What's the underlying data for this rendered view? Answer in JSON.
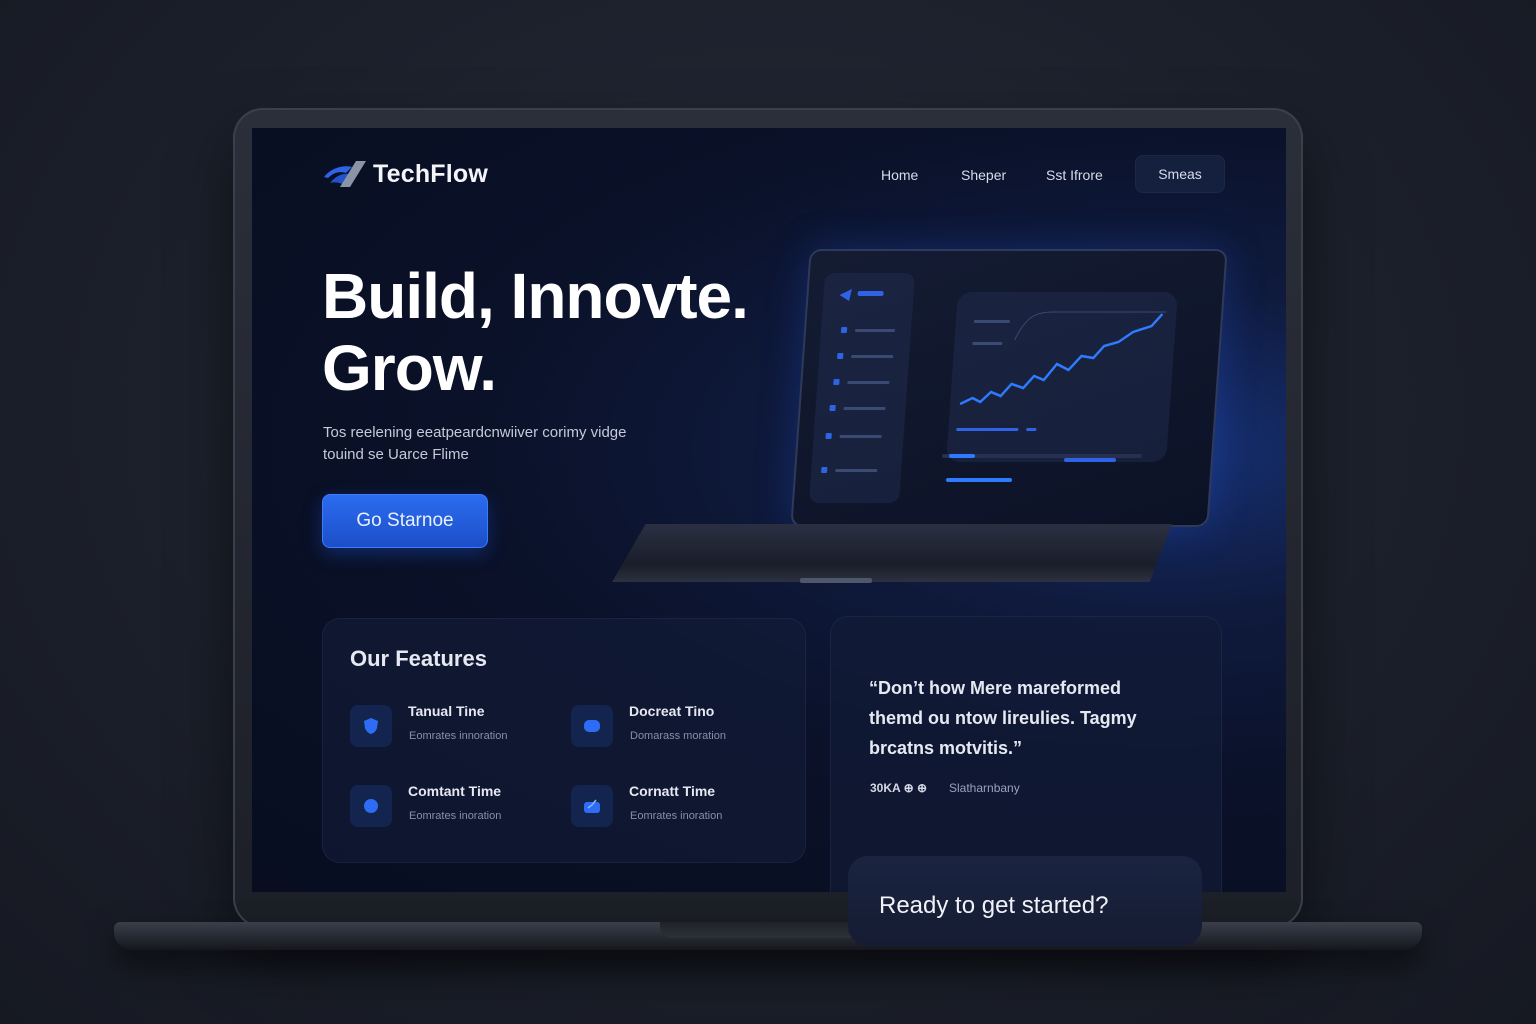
{
  "brand": {
    "name": "TechFlow"
  },
  "nav": {
    "links": [
      "Home",
      "Sheper",
      "Sst Ifrore"
    ],
    "button": "Smeas"
  },
  "hero": {
    "title_line1": "Build, Innovte.",
    "title_line2": "Grow.",
    "subtitle_line1": "Tos reelening eeatpeardcnwiiver corimy vidge",
    "subtitle_line2": "touind se Uarce Flime",
    "cta": "Go Starnoe"
  },
  "features": {
    "title": "Our Features",
    "items": [
      {
        "name": "Tanual Tine",
        "desc": "Eomrates innoration",
        "icon": "shield-icon"
      },
      {
        "name": "Docreat Tino",
        "desc": "Domarass moration",
        "icon": "cloud-icon"
      },
      {
        "name": "Comtant Time",
        "desc": "Eomrates inoration",
        "icon": "gear-icon"
      },
      {
        "name": "Cornatt Time",
        "desc": "Eomrates inoration",
        "icon": "chart-icon"
      }
    ]
  },
  "testimonial": {
    "quote_line1": "“Don’t how Mere mareformed",
    "quote_line2": "themd ou ntow lireulies. Tagmy",
    "quote_line3": "brcatns motvitis.”",
    "rating": "30KA ⊕ ⊕",
    "author": "Slatharnbany"
  },
  "ready": {
    "text": "Ready to get started?"
  },
  "colors": {
    "accent": "#2563eb",
    "background": "#0a1128",
    "surface": "#121c38"
  }
}
